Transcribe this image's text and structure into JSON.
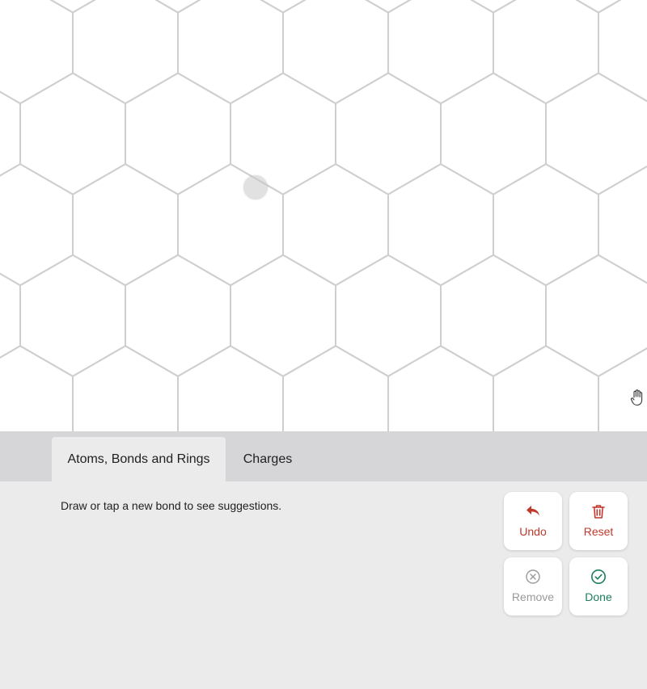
{
  "tabs": [
    {
      "label": "Atoms, Bonds and Rings",
      "active": true
    },
    {
      "label": "Charges",
      "active": false
    }
  ],
  "panel": {
    "hint": "Draw or tap a new bond to see suggestions."
  },
  "actions": {
    "undo": {
      "label": "Undo",
      "icon": "undo-arrow-icon"
    },
    "reset": {
      "label": "Reset",
      "icon": "trash-icon"
    },
    "remove": {
      "label": "Remove",
      "icon": "x-circle-icon"
    },
    "done": {
      "label": "Done",
      "icon": "check-circle-icon"
    }
  },
  "colors": {
    "danger": "#c0392b",
    "disabled": "#9a9a9a",
    "success": "#1e7d5f",
    "grid_line": "#cfcfd1",
    "panel_bg": "#ebebec",
    "tabbar_bg": "#d6d6d8"
  }
}
